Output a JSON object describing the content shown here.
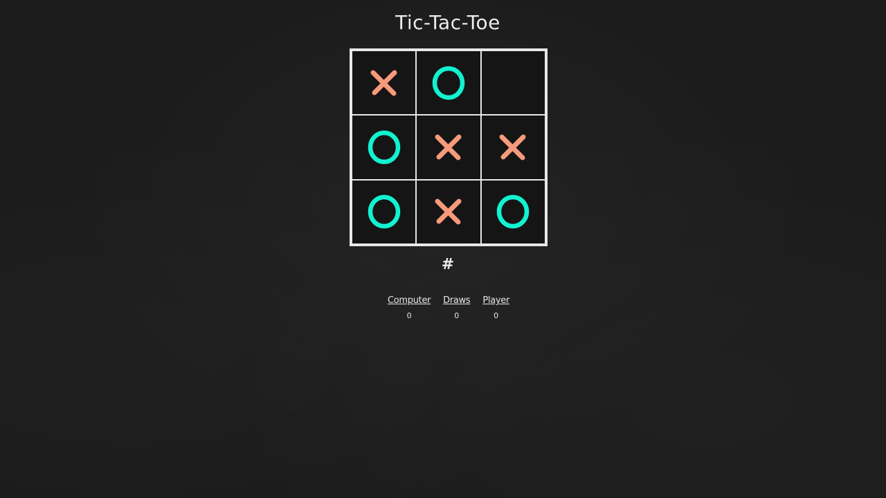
{
  "title": "Tic-Tac-Toe",
  "board": [
    "x",
    "o",
    "",
    "o",
    "x",
    "x",
    "o",
    "x",
    "o"
  ],
  "colors": {
    "x": "#f79a7c",
    "o": "#12f2d0",
    "grid": "#e8e8e8",
    "background": "#1b1b1b"
  },
  "status_symbol": "#",
  "scores": [
    {
      "label": "Computer",
      "value": "0"
    },
    {
      "label": "Draws",
      "value": "0"
    },
    {
      "label": "Player",
      "value": "0"
    }
  ]
}
